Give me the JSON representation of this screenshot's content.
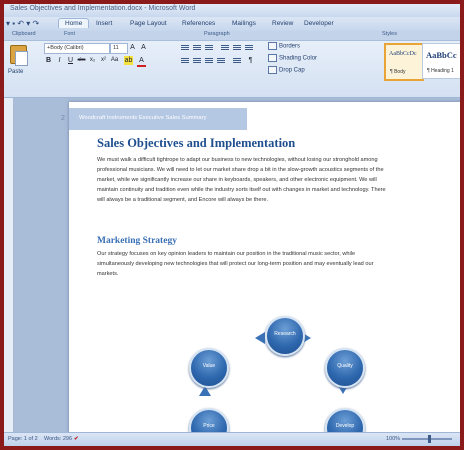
{
  "window": {
    "title": "Sales Objectives and Implementation.docx - Microsoft Word"
  },
  "tabs": [
    "Home",
    "Insert",
    "Page Layout",
    "References",
    "Mailings",
    "Review",
    "Developer"
  ],
  "active_tab": "Home",
  "ribbon": {
    "groups": [
      "Clipboard",
      "Font",
      "Paragraph",
      "Styles"
    ],
    "paste_label": "Paste",
    "font_name": "+Body (Calibri)",
    "font_size": "11",
    "format_buttons": [
      "B",
      "I",
      "U",
      "abc",
      "x₂",
      "x²",
      "Aa",
      "A"
    ],
    "side_buttons": [
      "Borders",
      "Shading Color",
      "Drop Cap"
    ],
    "styles": [
      {
        "sample": "AaBbCcDc",
        "name": "¶ Body"
      },
      {
        "sample": "AaBbCc",
        "name": "¶ Heading 1"
      }
    ]
  },
  "document": {
    "header_number": "2",
    "header_text": "Woodcraft Instruments Executive Sales Summary",
    "heading1": "Sales Objectives and Implementation",
    "paragraph1": [
      "We must walk a difficult tightrope to adapt our business to new technologies, without losing our stronghold among",
      "professional musicians. We will need to let our market share drop a bit in the slow-growth acoustics segments of the",
      "market, while we significantly increase our share in keyboards, speakers, and other electronic equipment. We will",
      "maintain continuity and tradition even while the industry sorts itself out with changes in market and technology. There",
      "will always be a traditional segment, and Encore will always be there."
    ],
    "heading2": "Marketing Strategy",
    "paragraph2": [
      "Our strategy focuses on key opinion leaders to maintain our position in the traditional music sector, while",
      "simultaneously developing new technologies that will protect our long-term position and may eventually lead our",
      "markets."
    ],
    "diagram_nodes": [
      "Research",
      "Quality",
      "Develop",
      "Price",
      "Value"
    ]
  },
  "statusbar": {
    "page": "Page: 1 of 2",
    "words": "Words: 296",
    "view": "100%"
  }
}
